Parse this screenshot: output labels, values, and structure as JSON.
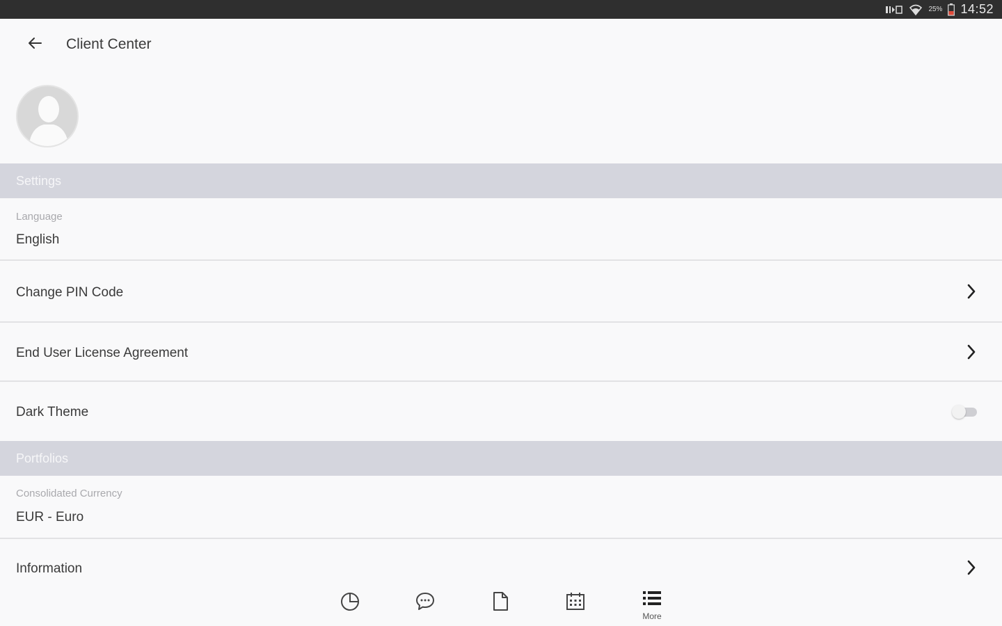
{
  "status_bar": {
    "battery_percent": "25%",
    "time": "14:52",
    "icons": [
      "nfc-icon",
      "wifi-icon",
      "battery-icon"
    ]
  },
  "header": {
    "title": "Client Center",
    "back_icon": "arrow-left-icon"
  },
  "profile": {
    "avatar_icon": "person-silhouette-icon"
  },
  "sections": {
    "settings": {
      "title": "Settings",
      "language": {
        "label": "Language",
        "value": "English"
      },
      "change_pin": {
        "label": "Change PIN Code"
      },
      "eula": {
        "label": "End User License Agreement"
      },
      "dark_theme": {
        "label": "Dark Theme",
        "enabled": false
      }
    },
    "portfolios": {
      "title": "Portfolios",
      "currency": {
        "label": "Consolidated Currency",
        "value": "EUR - Euro"
      },
      "information": {
        "label": "Information"
      }
    }
  },
  "bottom_nav": {
    "items": [
      {
        "icon": "pie-chart-icon",
        "label": ""
      },
      {
        "icon": "chat-bubble-icon",
        "label": ""
      },
      {
        "icon": "document-icon",
        "label": ""
      },
      {
        "icon": "calendar-icon",
        "label": ""
      },
      {
        "icon": "list-menu-icon",
        "label": "More",
        "active": true
      }
    ]
  },
  "colors": {
    "status_bar_bg": "#2f2f2f",
    "section_header_bg": "#d4d5dd",
    "background": "#f9f9fa",
    "divider": "#e2e2e4"
  }
}
